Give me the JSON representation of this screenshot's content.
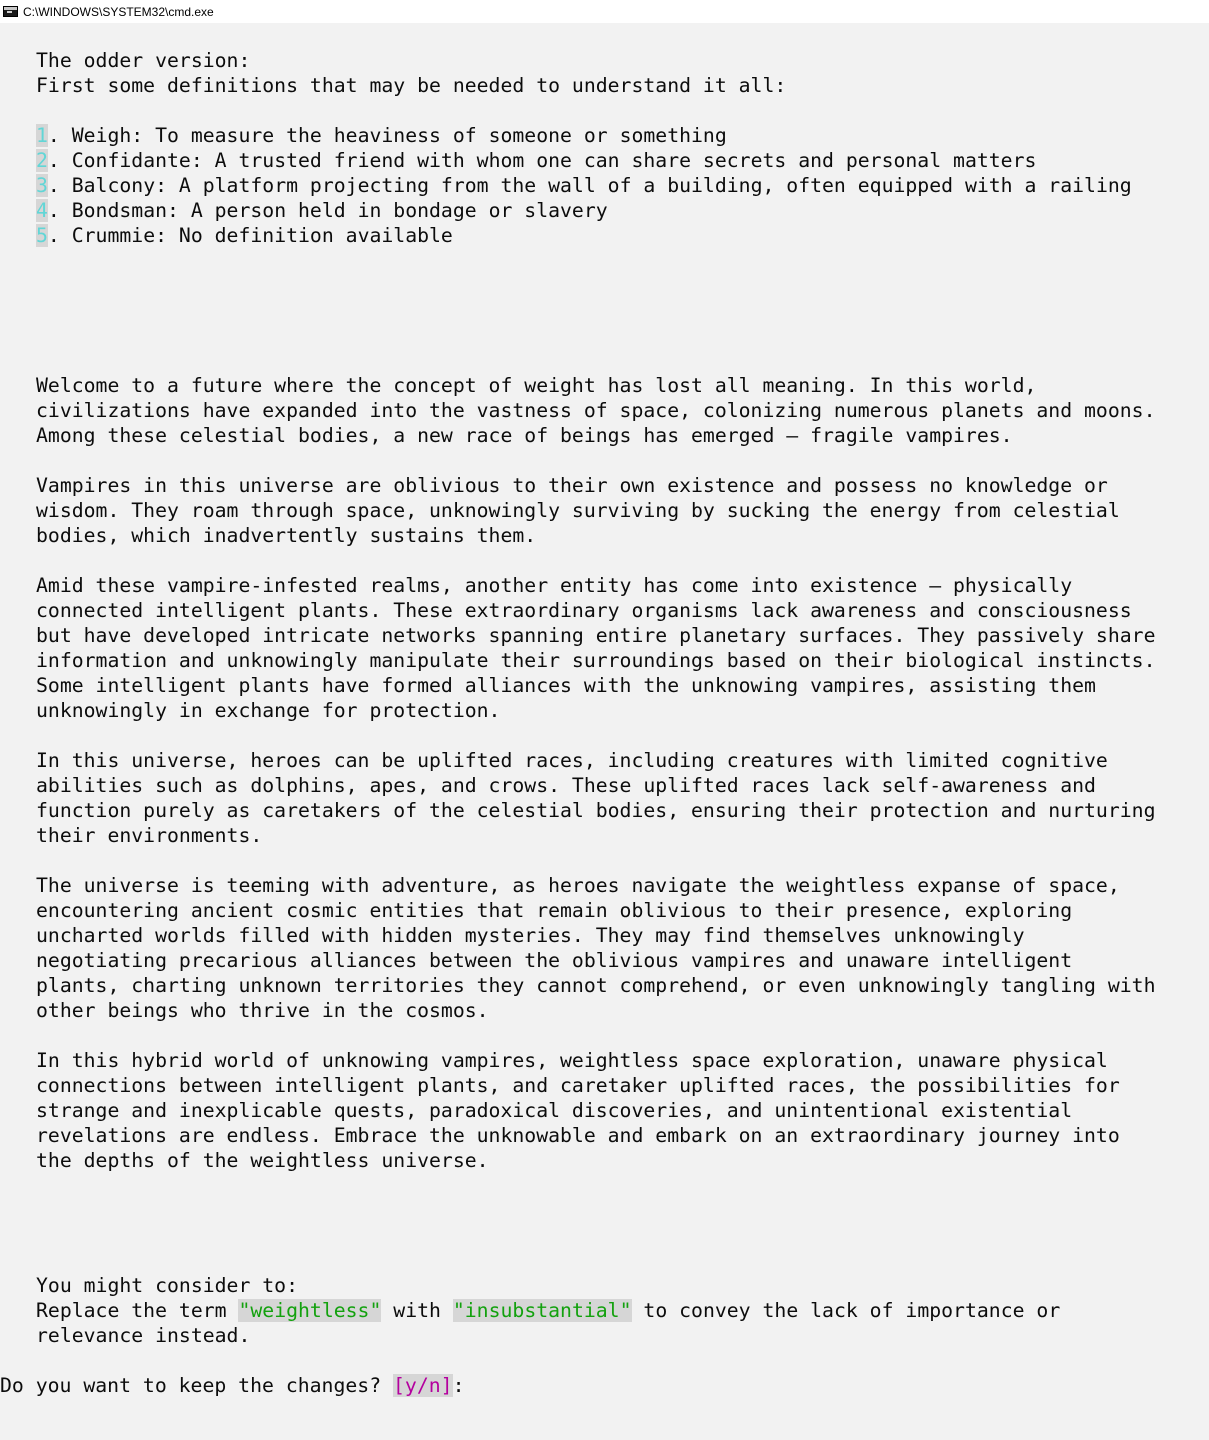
{
  "window": {
    "title": "C:\\WINDOWS\\SYSTEM32\\cmd.exe",
    "icon": "cmd-icon"
  },
  "console": {
    "header_line_1": "The odder version:",
    "header_line_2": "First some definitions that may be needed to understand it all:",
    "definitions": [
      {
        "num": "1",
        "text": ". Weigh: To measure the heaviness of someone or something"
      },
      {
        "num": "2",
        "text": ". Confidante: A trusted friend with whom one can share secrets and personal matters"
      },
      {
        "num": "3",
        "text": ". Balcony: A platform projecting from the wall of a building, often equipped with a railing"
      },
      {
        "num": "4",
        "text": ". Bondsman: A person held in bondage or slavery"
      },
      {
        "num": "5",
        "text": ". Crummie: No definition available"
      }
    ],
    "story_lines": [
      "Welcome to a future where the concept of weight has lost all meaning. In this world,",
      "civilizations have expanded into the vastness of space, colonizing numerous planets and moons.",
      "Among these celestial bodies, a new race of beings has emerged – fragile vampires.",
      "",
      "Vampires in this universe are oblivious to their own existence and possess no knowledge or",
      "wisdom. They roam through space, unknowingly surviving by sucking the energy from celestial",
      "bodies, which inadvertently sustains them.",
      "",
      "Amid these vampire-infested realms, another entity has come into existence – physically",
      "connected intelligent plants. These extraordinary organisms lack awareness and consciousness",
      "but have developed intricate networks spanning entire planetary surfaces. They passively share",
      "information and unknowingly manipulate their surroundings based on their biological instincts.",
      "Some intelligent plants have formed alliances with the unknowing vampires, assisting them",
      "unknowingly in exchange for protection.",
      "",
      "In this universe, heroes can be uplifted races, including creatures with limited cognitive",
      "abilities such as dolphins, apes, and crows. These uplifted races lack self-awareness and",
      "function purely as caretakers of the celestial bodies, ensuring their protection and nurturing",
      "their environments.",
      "",
      "The universe is teeming with adventure, as heroes navigate the weightless expanse of space,",
      "encountering ancient cosmic entities that remain oblivious to their presence, exploring",
      "uncharted worlds filled with hidden mysteries. They may find themselves unknowingly",
      "negotiating precarious alliances between the oblivious vampires and unaware intelligent",
      "plants, charting unknown territories they cannot comprehend, or even unknowingly tangling with",
      "other beings who thrive in the cosmos.",
      "",
      "In this hybrid world of unknowing vampires, weightless space exploration, unaware physical",
      "connections between intelligent plants, and caretaker uplifted races, the possibilities for",
      "strange and inexplicable quests, paradoxical discoveries, and unintentional existential",
      "revelations are endless. Embrace the unknowable and embark on an extraordinary journey into",
      "the depths of the weightless universe."
    ],
    "suggestion": {
      "intro": "You might consider to:",
      "prefix": "Replace the term ",
      "old_term": "\"weightless\"",
      "middle": " with ",
      "new_term": "\"insubstantial\"",
      "suffix": " to convey the lack of importance or",
      "continuation": "relevance instead."
    },
    "prompt": {
      "question": "Do you want to keep the changes? ",
      "options": "[y/n]",
      "colon": ":"
    }
  },
  "colors": {
    "background": "#f2f2f2",
    "text": "#0c0c0c",
    "number_highlight": "#61d6d6",
    "green_highlight": "#13a10e",
    "magenta_highlight": "#b4009e",
    "highlight_background": "#d6d6d6"
  }
}
